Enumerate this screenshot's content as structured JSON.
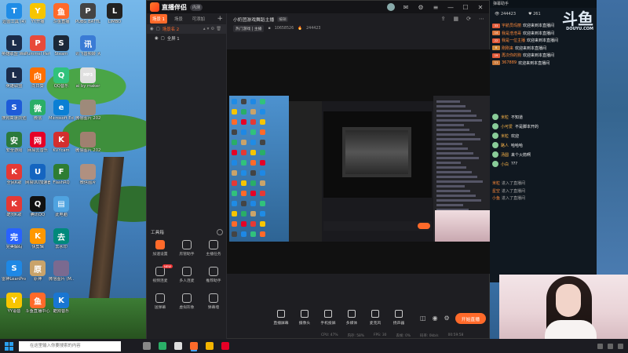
{
  "desktop": {
    "icons": [
      {
        "label": "迅雷工具 (4)",
        "color": "#1f8ce6",
        "glyph": "T"
      },
      {
        "label": "YY开播",
        "color": "#f7c500",
        "glyph": "Y"
      },
      {
        "label": "斗鱼直播",
        "color": "#ff6a2a",
        "glyph": "鱼"
      },
      {
        "label": "PUBG BATTLEGR...",
        "color": "#444",
        "glyph": "P"
      },
      {
        "label": "LIMBO",
        "color": "#222",
        "glyph": "L"
      },
      {
        "label": "英雄联盟 WeGame版",
        "color": "#1b2c4a",
        "glyph": "L"
      },
      {
        "label": "Pummel Party",
        "color": "#e84a3a",
        "glyph": "P"
      },
      {
        "label": "Steam",
        "color": "#1b2838",
        "glyph": "S"
      },
      {
        "label": "讯飞音频转 大师",
        "color": "#3a7bd5",
        "glyph": "讯"
      },
      {
        "label": "英雄联盟",
        "color": "#1b2c4a",
        "glyph": "L"
      },
      {
        "label": "向日葵",
        "color": "#ff6f00",
        "glyph": "向"
      },
      {
        "label": "QQ音乐",
        "color": "#31c27c",
        "glyph": "Q"
      },
      {
        "label": "ai by maker",
        "color": "#e0e0e0",
        "glyph": "MP3"
      },
      {
        "label": "搜狗高速浏览器",
        "color": "#1e5bd8",
        "glyph": "S"
      },
      {
        "label": "微信",
        "color": "#2aae67",
        "glyph": "微"
      },
      {
        "label": "Microsoft Edge",
        "color": "#0a7fd4",
        "glyph": "e"
      },
      {
        "label": "安全游戏",
        "color": "#2c7a3b",
        "glyph": "安"
      },
      {
        "label": "网易云音乐",
        "color": "#e60026",
        "glyph": "网"
      },
      {
        "label": "KVYcam",
        "color": "#d32f2f",
        "glyph": "K"
      },
      {
        "label": "全民K歌",
        "color": "#e53935",
        "glyph": "K"
      },
      {
        "label": "网易UU加速器",
        "color": "#1565c0",
        "glyph": "U"
      },
      {
        "label": "FlashRQ",
        "color": "#2e7d32",
        "glyph": "F"
      },
      {
        "label": "酷狗K歌",
        "color": "#e53935",
        "glyph": "K"
      },
      {
        "label": "腾讯QQ",
        "color": "#111",
        "glyph": "Q"
      },
      {
        "label": "此电脑",
        "color": "#4fa3e0",
        "glyph": "▤"
      },
      {
        "label": "完美解码",
        "color": "#2962ff",
        "glyph": "完"
      },
      {
        "label": "快剪辑",
        "color": "#ff9800",
        "glyph": "K"
      },
      {
        "label": "去水印",
        "color": "#00897b",
        "glyph": "去"
      },
      {
        "label": "微信图片 2022021...",
        "color": "#9e8a7a",
        "glyph": ""
      },
      {
        "label": "雷神LeanPro 打开",
        "color": "#1e88e5",
        "glyph": "S"
      },
      {
        "label": "原神",
        "color": "#c9a36a",
        "glyph": "原"
      },
      {
        "label": "微信图片 (M...",
        "color": "#7a6a90",
        "glyph": ""
      },
      {
        "label": "微信图片 2022...",
        "color": "#a08070",
        "glyph": ""
      },
      {
        "label": "YY语音",
        "color": "#f7c500",
        "glyph": "Y"
      },
      {
        "label": "斗鱼直播中心",
        "color": "#ff6a2a",
        "glyph": "鱼"
      },
      {
        "label": "酷狗音乐",
        "color": "#1976d2",
        "glyph": "K"
      },
      {
        "label": "微信图片",
        "color": "#b09080",
        "glyph": ""
      }
    ]
  },
  "app": {
    "name": "直播伴侣",
    "version": "内测",
    "scene_tabs": [
      "场景 1",
      "场景",
      "可添加"
    ],
    "scene_name": "场景名 2",
    "source_name": "全屏 1",
    "toolbox_title": "工具箱",
    "tools": [
      {
        "label": "加速设置",
        "badge": "",
        "hot": true
      },
      {
        "label": "房管助手",
        "badge": "",
        "hot": false
      },
      {
        "label": "主播任务",
        "badge": "",
        "hot": false
      },
      {
        "label": "视频连麦",
        "badge": "NEW",
        "hot": false
      },
      {
        "label": "多人连麦",
        "badge": "",
        "hot": false
      },
      {
        "label": "推荐助手",
        "badge": "",
        "hot": false
      },
      {
        "label": "送弹幕",
        "badge": "",
        "hot": false
      },
      {
        "label": "虚拟形象",
        "badge": "",
        "hot": false
      },
      {
        "label": "弹幕墙",
        "badge": "",
        "hot": false
      }
    ],
    "room_title": "小奶团游戏舞蹈主播",
    "room_edit": "编辑",
    "room_category": "热门游戏 | 主播",
    "room_id": "10658526",
    "room_hot": "244423",
    "bottom_items": [
      "直播屏幕",
      "摄像头",
      "手机投屏",
      "多媒体",
      "麦克风",
      "扬声器"
    ],
    "go_live": "开始直播",
    "status": [
      "CPU: 47%",
      "内存: 58%",
      "FPS: 30",
      "丢帧: 0%",
      "码率: 0kb/s",
      "00:59:58"
    ]
  },
  "chat": {
    "title": "弹幕助手",
    "online": "244423",
    "fans": "261",
    "douyu_logo": "斗鱼",
    "douyu_sub": "DOUYU.COM",
    "messages": [
      {
        "level": "33",
        "color": "#e05a3a",
        "name": "宇航员玛丽",
        "text": "欢迎来到本直播间"
      },
      {
        "level": "14",
        "color": "#d9733a",
        "name": "我是浩浩哥",
        "text": "欢迎来到本直播间"
      },
      {
        "level": "22",
        "color": "#e05a3a",
        "name": "我是一位主播",
        "text": "欢迎来到本直播间"
      },
      {
        "level": "8",
        "color": "#d08a3a",
        "name": "刚刚来",
        "text": "欢迎来到本直播间"
      },
      {
        "level": "19",
        "color": "#e05a3a",
        "name": "再次你的狗",
        "text": "欢迎来到本直播间"
      },
      {
        "level": "11",
        "color": "#c9793a",
        "name": "367889",
        "text": "欢迎来到本直播间"
      }
    ],
    "chats": [
      {
        "name": "米粒",
        "text": "不知道"
      },
      {
        "name": "小可爱",
        "text": "不是脚本开的"
      },
      {
        "name": "米粒",
        "text": "欢迎"
      },
      {
        "name": "路人",
        "text": "哈哈哈"
      },
      {
        "name": "汤圆",
        "text": "来个火箭啊"
      },
      {
        "name": "小白",
        "text": "???"
      }
    ],
    "system": [
      {
        "name": "米粒",
        "text": "进入了直播间"
      },
      {
        "name": "星空",
        "text": "进入了直播间"
      },
      {
        "name": "小鱼",
        "text": "进入了直播间"
      }
    ]
  },
  "taskbar": {
    "search_placeholder": "在这里输入你要搜索的内容",
    "apps": [
      {
        "name": "task-view",
        "color": "#888"
      },
      {
        "name": "wechat",
        "color": "#2aae67"
      },
      {
        "name": "browser",
        "color": "#ddd"
      },
      {
        "name": "douyu-live",
        "color": "#ff6a2a"
      },
      {
        "name": "chrome",
        "color": "#f4b400"
      },
      {
        "name": "netease-music",
        "color": "#e60026"
      }
    ]
  }
}
